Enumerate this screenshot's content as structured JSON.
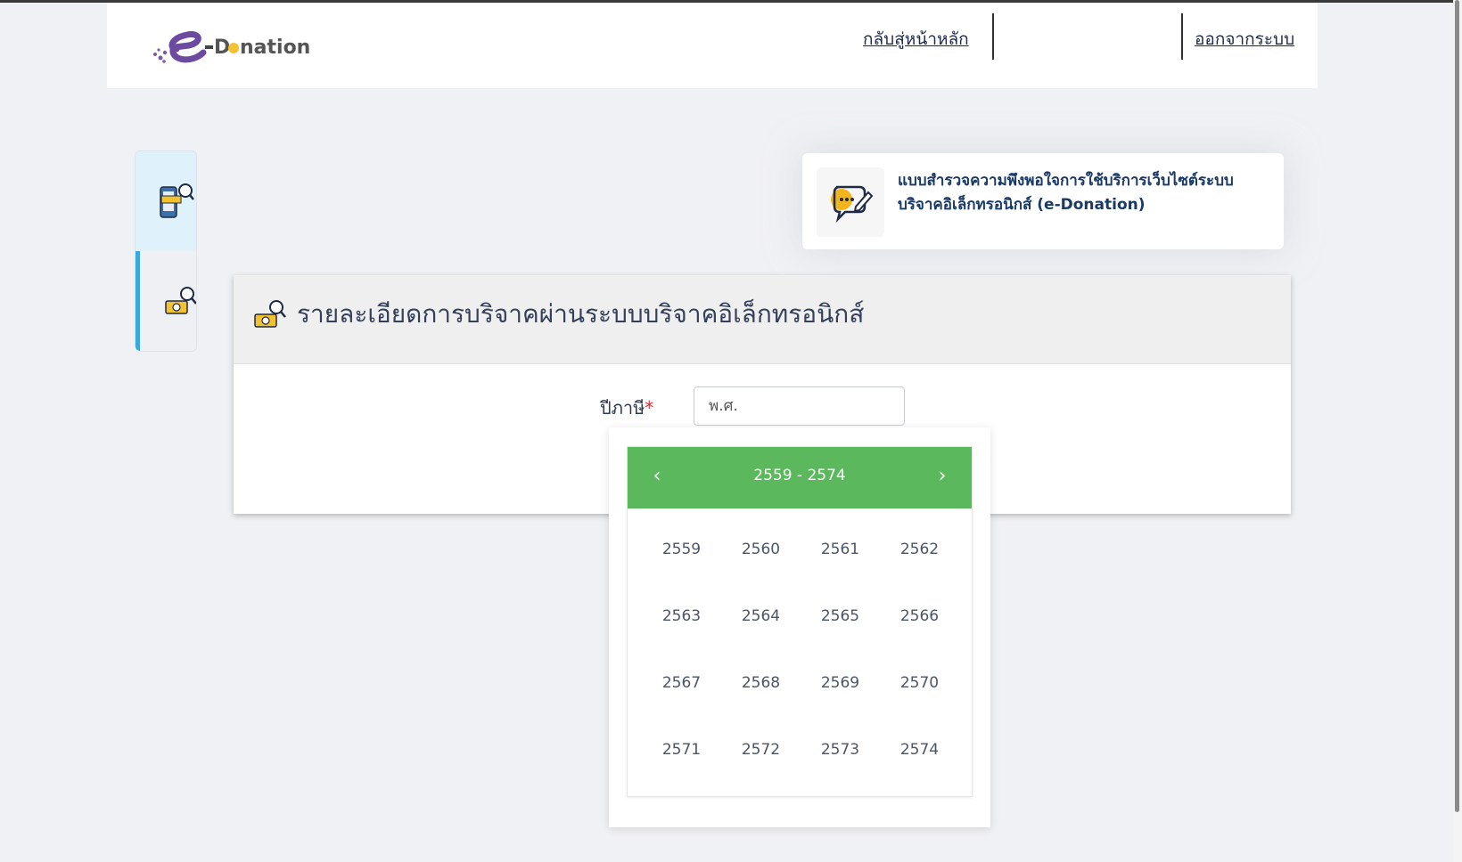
{
  "header": {
    "logo_text": "e-Donation",
    "nav_home": "กลับสู่หน้าหลัก",
    "nav_logout": "ออกจากระบบ"
  },
  "sidenav": {
    "items": [
      {
        "icon": "donate-phone-search-icon",
        "active": false
      },
      {
        "icon": "money-search-icon",
        "active": true
      }
    ]
  },
  "survey": {
    "text": "แบบสำรวจความพึงพอใจการใช้บริการเว็บไซต์ระบบบริจาคอิเล็กทรอนิกส์ (e-Donation)",
    "icon": "chat-edit-icon"
  },
  "panel": {
    "title": "รายละเอียดการบริจาคผ่านระบบบริจาคอิเล็กทรอนิกส์",
    "icon": "money-search-icon"
  },
  "form": {
    "year_label": "ปีภาษี",
    "required_mark": "*",
    "year_placeholder": "พ.ศ."
  },
  "year_picker": {
    "range_label": "2559 - 2574",
    "prev_label": "‹",
    "next_label": "›",
    "header_color": "#5cb85c",
    "years": [
      "2559",
      "2560",
      "2561",
      "2562",
      "2563",
      "2564",
      "2565",
      "2566",
      "2567",
      "2568",
      "2569",
      "2570",
      "2571",
      "2572",
      "2573",
      "2574"
    ]
  }
}
